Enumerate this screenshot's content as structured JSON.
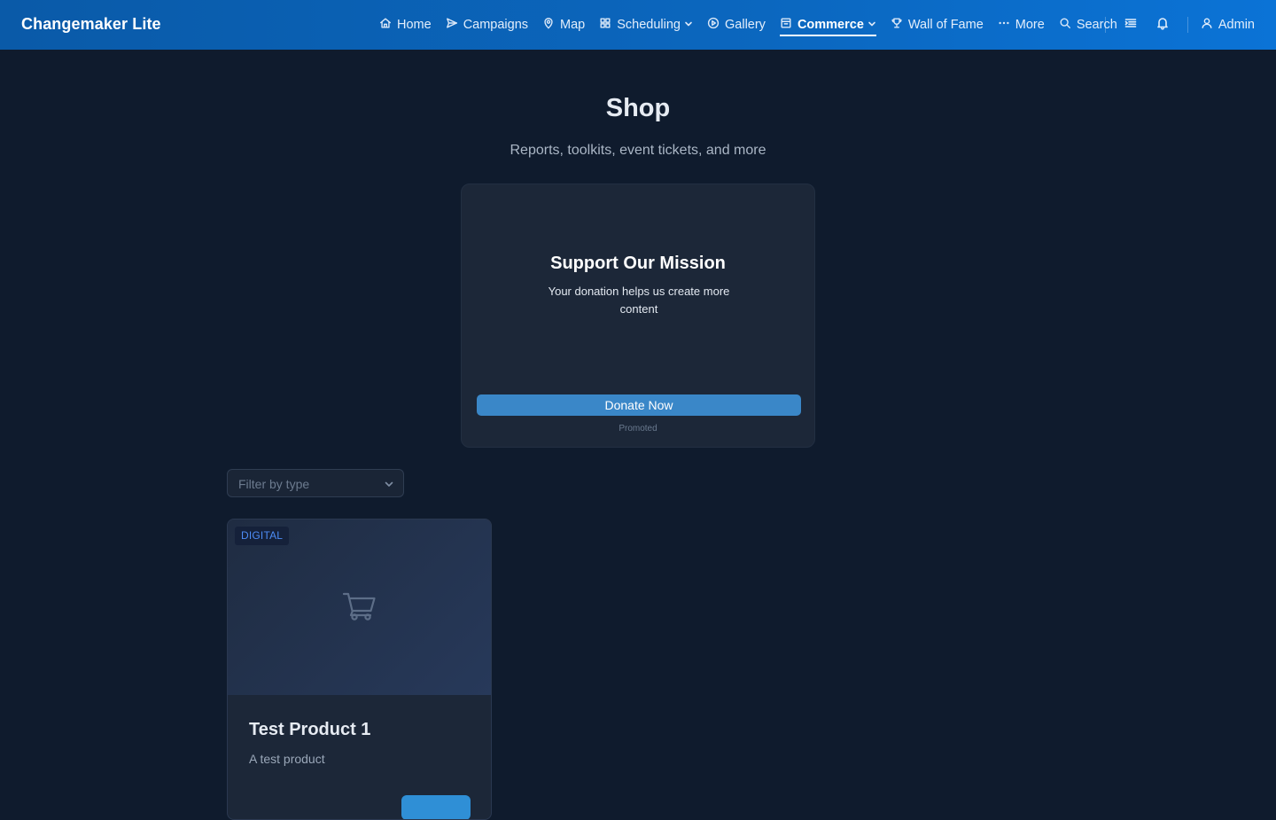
{
  "app": {
    "title": "Changemaker Lite"
  },
  "nav": {
    "items": [
      {
        "label": "Home",
        "icon": "home-icon"
      },
      {
        "label": "Campaigns",
        "icon": "send-icon"
      },
      {
        "label": "Map",
        "icon": "map-pin-icon"
      },
      {
        "label": "Scheduling",
        "icon": "grid-icon",
        "dropdown": true
      },
      {
        "label": "Gallery",
        "icon": "play-circle-icon"
      },
      {
        "label": "Commerce",
        "icon": "shop-icon",
        "dropdown": true,
        "active": true
      },
      {
        "label": "Wall of Fame",
        "icon": "trophy-icon"
      },
      {
        "label": "More",
        "icon": "ellipsis-icon"
      },
      {
        "label": "Search",
        "icon": "search-icon"
      }
    ],
    "user_label": "Admin"
  },
  "page": {
    "title": "Shop",
    "subtitle": "Reports, toolkits, event tickets, and more"
  },
  "promo": {
    "title": "Support Our Mission",
    "text": "Your donation helps us create more content",
    "button_label": "Donate Now",
    "footer": "Promoted"
  },
  "filter": {
    "placeholder": "Filter by type"
  },
  "products": [
    {
      "badge": "DIGITAL",
      "title": "Test Product 1",
      "description": "A test product"
    }
  ],
  "colors": {
    "header_bg": "#0b67bf",
    "page_bg": "#0f1b2d",
    "card_bg": "#1c2738",
    "accent": "#3a87c8",
    "badge_text": "#4d8cf5"
  }
}
